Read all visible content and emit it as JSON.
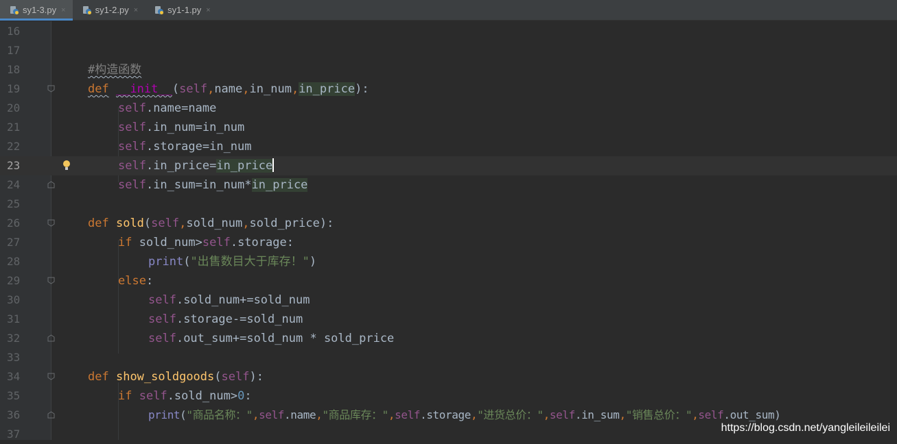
{
  "tabs": [
    {
      "label": "sy1-3.py",
      "active": true
    },
    {
      "label": "sy1-2.py",
      "active": false
    },
    {
      "label": "sy1-1.py",
      "active": false
    }
  ],
  "tab_close_glyph": "×",
  "line_numbers": [
    "16",
    "17",
    "18",
    "19",
    "20",
    "21",
    "22",
    "23",
    "24",
    "25",
    "26",
    "27",
    "28",
    "29",
    "30",
    "31",
    "32",
    "33",
    "34",
    "35",
    "36",
    "37"
  ],
  "code": {
    "comment_init": "#构造函数",
    "kw_def": "def",
    "init_name": "__init__",
    "self": "self",
    "p_name": "name",
    "p_in_num": "in_num",
    "p_in_price": "in_price",
    "attr_name": ".name",
    "attr_in_num": ".in_num",
    "attr_storage": ".storage",
    "attr_in_price": ".in_price",
    "attr_in_sum": ".in_sum",
    "attr_sold_num": ".sold_num",
    "attr_out_sum": ".out_sum",
    "fn_sold": "sold",
    "p_sold_num": "sold_num",
    "p_sold_price": "sold_price",
    "kw_if": "if",
    "kw_else": "else",
    "print": "print",
    "str_not_enough": "\"出售数目大于库存！\"",
    "fn_show": "show_soldgoods",
    "num_zero": "0",
    "str_goods_name": "\"商品名称：\"",
    "str_stock": "\"商品库存：\"",
    "str_in_total": "\"进货总价：\"",
    "str_sale_total": "\"销售总价：\""
  },
  "watermark": "https://blog.csdn.net/yangleileileilei",
  "colors": {
    "background": "#2b2b2b",
    "keyword": "#cc7832",
    "self": "#94558d",
    "function": "#ffc66d",
    "string": "#6a8759",
    "number": "#6897bb",
    "comment": "#808080",
    "builtin": "#8888c6"
  },
  "icons": {
    "file_tab": "python-file-icon",
    "gutter_bulb": "lightbulb-icon",
    "fold": "fold-marker-icon"
  }
}
